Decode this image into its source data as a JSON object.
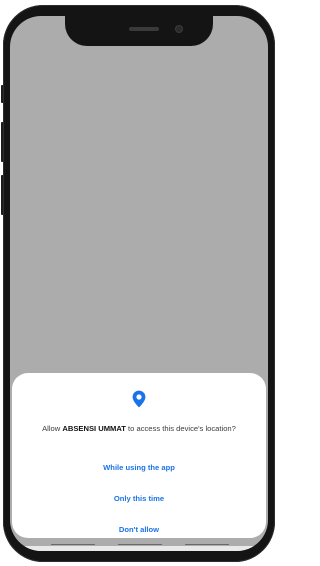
{
  "permission_dialog": {
    "icon": "location-pin-icon",
    "message_prefix": "Allow ",
    "app_name": "ABSENSI UMMAT",
    "message_suffix": " to access this device's location?",
    "options": {
      "while_using": "While using the app",
      "only_this_time": "Only this time",
      "dont_allow": "Don't allow"
    }
  },
  "colors": {
    "accent": "#1a73e8",
    "scrim": "#acacac",
    "dialog_background": "#ffffff",
    "device_frame": "#141414"
  }
}
